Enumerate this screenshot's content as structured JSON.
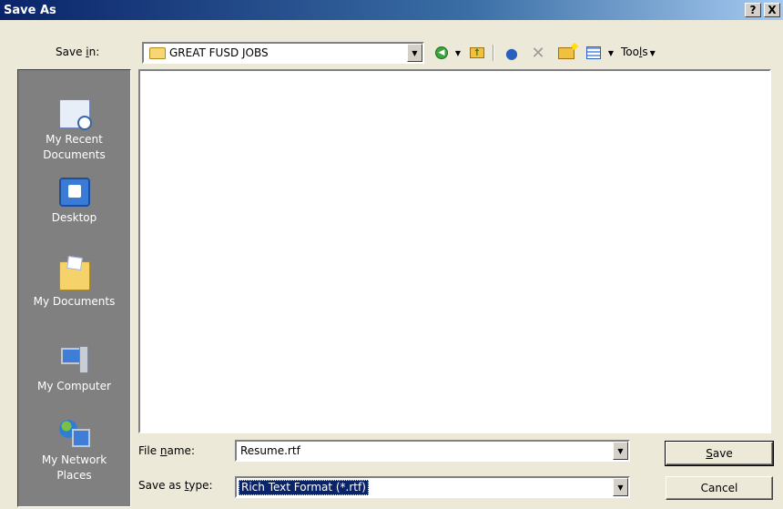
{
  "window": {
    "title": "Save As",
    "help_label": "?",
    "close_label": "X"
  },
  "save_in": {
    "label_pre": "Save ",
    "label_accel": "i",
    "label_post": "n:",
    "value": "GREAT FUSD JOBS"
  },
  "toolbar": {
    "tools_pre": "Too",
    "tools_accel": "l",
    "tools_post": "s"
  },
  "places": [
    {
      "line1": "My Recent",
      "line2": "Documents",
      "icon": "recent-documents-icon"
    },
    {
      "line1": "Desktop",
      "line2": "",
      "icon": "desktop-icon"
    },
    {
      "line1": "My Documents",
      "line2": "",
      "icon": "my-documents-icon"
    },
    {
      "line1": "My Computer",
      "line2": "",
      "icon": "my-computer-icon"
    },
    {
      "line1": "My Network",
      "line2": "Places",
      "icon": "my-network-places-icon"
    }
  ],
  "file_name": {
    "label_pre": "File ",
    "label_accel": "n",
    "label_post": "ame:",
    "value": "Resume.rtf"
  },
  "file_type": {
    "label_pre": "Save as ",
    "label_accel": "t",
    "label_post": "ype:",
    "value": "Rich Text Format (*.rtf)"
  },
  "buttons": {
    "save_accel": "S",
    "save_rest": "ave",
    "cancel": "Cancel"
  },
  "colors": {
    "title_bar": "#0a246a",
    "dialog_bg": "#ece9d8",
    "places_bg": "#808080",
    "selection": "#0a246a"
  }
}
